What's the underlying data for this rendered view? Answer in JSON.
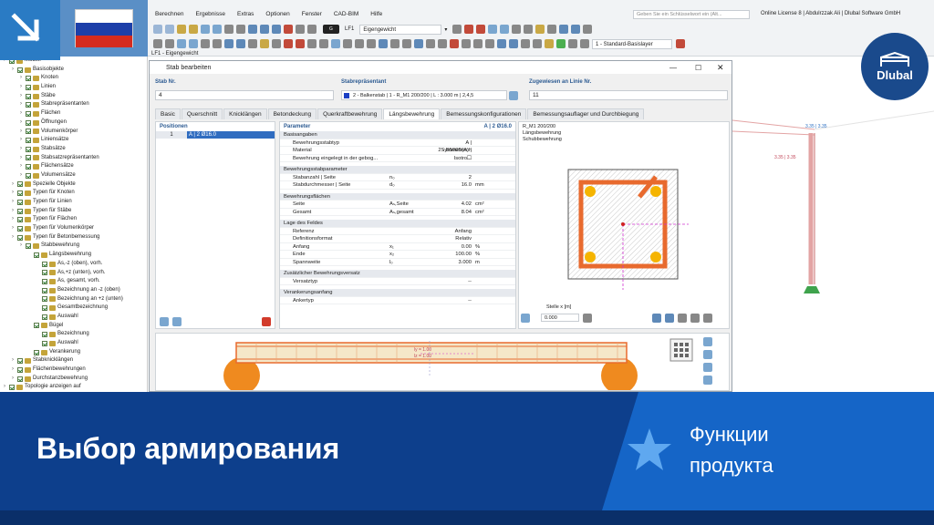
{
  "menu": [
    "Berechnen",
    "Ergebnisse",
    "Extras",
    "Optionen",
    "Fenster",
    "CAD-BIM",
    "Hilfe"
  ],
  "search_placeholder": "Geben Sie ein Schlüsselwort ein (Alt...",
  "license": "Online License 8 | Abdulrzzak Ali | Dlubal Software GmbH",
  "loadcase_code": "G",
  "loadcase_id": "LF1",
  "loadcase_name": "Eigengewicht",
  "basislayer": "1 - Standard-Basislayer",
  "view_tab": "LF1 - Eigengewicht",
  "tree": [
    {
      "t": "Modell",
      "lvl": 0
    },
    {
      "t": "Basisobjekte",
      "lvl": 1
    },
    {
      "t": "Knoten",
      "lvl": 2
    },
    {
      "t": "Linien",
      "lvl": 2
    },
    {
      "t": "Stäbe",
      "lvl": 2
    },
    {
      "t": "Stabrepräsentanten",
      "lvl": 2
    },
    {
      "t": "Flächen",
      "lvl": 2
    },
    {
      "t": "Öffnungen",
      "lvl": 2
    },
    {
      "t": "Volumenkörper",
      "lvl": 2
    },
    {
      "t": "Liniensätze",
      "lvl": 2
    },
    {
      "t": "Stabsätze",
      "lvl": 2
    },
    {
      "t": "Stabsatzrepräsentanten",
      "lvl": 2
    },
    {
      "t": "Flächensätze",
      "lvl": 2
    },
    {
      "t": "Volumensätze",
      "lvl": 2
    },
    {
      "t": "Spezielle Objekte",
      "lvl": 1
    },
    {
      "t": "Typen für Knoten",
      "lvl": 1
    },
    {
      "t": "Typen für Linien",
      "lvl": 1
    },
    {
      "t": "Typen für Stäbe",
      "lvl": 1
    },
    {
      "t": "Typen für Flächen",
      "lvl": 1
    },
    {
      "t": "Typen für Volumenkörper",
      "lvl": 1
    },
    {
      "t": "Typen für Betonbemessung",
      "lvl": 1
    },
    {
      "t": "Stabbewehrung",
      "lvl": 2
    },
    {
      "t": "Längsbewehrung",
      "lvl": 3
    },
    {
      "t": "As,-z (oben), vorh.",
      "lvl": 4
    },
    {
      "t": "As,+z (unten), vorh.",
      "lvl": 4
    },
    {
      "t": "As, gesamt, vorh.",
      "lvl": 4
    },
    {
      "t": "Bezeichnung an -z (oben)",
      "lvl": 4
    },
    {
      "t": "Bezeichnung an +z (unten)",
      "lvl": 4
    },
    {
      "t": "Gesamtbezeichnung",
      "lvl": 4
    },
    {
      "t": "Auswahl",
      "lvl": 4
    },
    {
      "t": "Bügel",
      "lvl": 3
    },
    {
      "t": "Bezeichnung",
      "lvl": 4
    },
    {
      "t": "Auswahl",
      "lvl": 4
    },
    {
      "t": "Verankerung",
      "lvl": 3
    },
    {
      "t": "Stabknicklängen",
      "lvl": 1
    },
    {
      "t": "Flächenbewehrungen",
      "lvl": 1
    },
    {
      "t": "Durchstanzbewehrung",
      "lvl": 1
    },
    {
      "t": "Topologie anzeigen auf",
      "lvl": 0
    }
  ],
  "dialog": {
    "title": "Stab bearbeiten",
    "stab_nr_label": "Stab Nr.",
    "stab_nr": "4",
    "rep_label": "Stabrepräsentant",
    "rep": "2 - Balkenstab | 1 - R_M1 200/200 | L : 3.000 m | 2,4,5",
    "linie_label": "Zugewiesen an Linie Nr.",
    "linie": "11",
    "tabs": [
      "Basic",
      "Querschnitt",
      "Knicklängen",
      "Betondeckung",
      "Querkraftbewehrung",
      "Längsbewehrung",
      "Bemessungskonfigurationen",
      "Bemessungsauflager und Durchbiegung"
    ],
    "positions_label": "Positionen",
    "pos_row_no": "1",
    "pos_row": "A | 2 Ø16.0",
    "param_label": "Parameter",
    "param_sel": "A | 2 Ø16.0",
    "groups": [
      {
        "name": "Basisangaben",
        "rows": [
          [
            "Bewehrungsstabtyp",
            "",
            "A | Symmetrisch",
            ""
          ],
          [
            "Material",
            "",
            "2 - B500S(A) | Isotro...",
            ""
          ],
          [
            "Bewehrung eingelegt in der gebog...",
            "",
            "☐",
            ""
          ]
        ]
      },
      {
        "name": "Bewehrungsstabparameter",
        "rows": [
          [
            "Stabanzahl | Seite",
            "n₀",
            "2",
            ""
          ],
          [
            "Stabdurchmesser | Seite",
            "d₀",
            "16.0",
            "mm"
          ]
        ]
      },
      {
        "name": "Bewehrungsflächen",
        "rows": [
          [
            "Seite",
            "Aₛ,Seite",
            "4.02",
            "cm²"
          ],
          [
            "Gesamt",
            "Aₛ,gesamt",
            "8.04",
            "cm²"
          ]
        ]
      },
      {
        "name": "Lage des Feldes",
        "rows": [
          [
            "Referenz",
            "",
            "Anfang",
            ""
          ],
          [
            "Definitionsformat",
            "",
            "Relativ",
            ""
          ],
          [
            "Anfang",
            "x₁",
            "0.00",
            "%"
          ],
          [
            "Ende",
            "x₂",
            "100.00",
            "%"
          ],
          [
            "Spannweite",
            "l₀",
            "3.000",
            "m"
          ]
        ]
      },
      {
        "name": "Zusätzlicher Bewehrungsversatz",
        "rows": [
          [
            "Versatztyp",
            "",
            "--",
            ""
          ]
        ]
      },
      {
        "name": "Verankerungsanfang",
        "rows": [
          [
            "Ankertyp",
            "",
            "--",
            ""
          ]
        ]
      }
    ],
    "preview_lines": [
      "R_M1 200/200",
      "Längsbewehrung",
      "Schubbewehrung"
    ],
    "stelle_label": "Stelle x [m]",
    "stelle": "0.000",
    "beam_labels": [
      "ly = 1.00",
      "lz = 1.00"
    ]
  },
  "viewport_labels": [
    "3.35 | 3.35",
    "3.35 | 3.35"
  ],
  "banner": {
    "title": "Выбор армирования",
    "subtitle1": "Функции",
    "subtitle2": "продукта",
    "logo": "Dlubal"
  },
  "colors": {
    "banner": "#0d3f8c",
    "accent": "#1565c7",
    "rebar": "#e86a2e",
    "support": "#ef8a1f"
  }
}
